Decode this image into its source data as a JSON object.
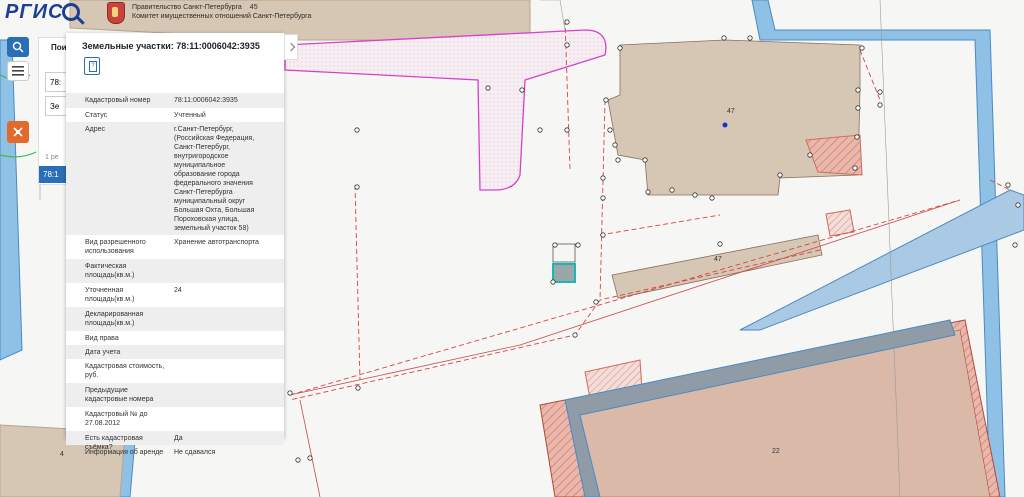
{
  "header": {
    "logo": "РГИС",
    "gov_line1": "Правительство Санкт-Петербурга",
    "gov_number": "45",
    "gov_line2": "Комитет имущественных отношений Санкт-Петербурга"
  },
  "background_panel": {
    "title": "Пои",
    "field1": "78:",
    "field2": "Зе",
    "results": "1 ре",
    "selected": "78:1"
  },
  "popup": {
    "title": "Земельные участки: 78:11:0006042:3935",
    "help_icon": "question-doc-icon",
    "rows": [
      {
        "key": "Кадастровый номер",
        "value": "78:11:0006042:3935"
      },
      {
        "key": "Статус",
        "value": "Учтенный"
      },
      {
        "key": "Адрес",
        "value": "г.Санкт-Петербург, (Российская Федерация, Санкт-Петербург, внутригородское муниципальное образование города федерального значения Санкт-Петербурга муниципальный округ Большая Охта, Большая Пороховская улица, земельный участок 58)"
      },
      {
        "key": "Вид разрешенного использования",
        "value": "Хранение автотранспорта"
      },
      {
        "key": "Фактическая площадь(кв.м.)",
        "value": ""
      },
      {
        "key": "Уточненная площадь(кв.м.)",
        "value": "24"
      },
      {
        "key": "Декларированная площадь(кв.м.)",
        "value": ""
      },
      {
        "key": "Вид права",
        "value": ""
      },
      {
        "key": "Дата учета",
        "value": ""
      },
      {
        "key": "Кадастровая стоимость, руб.",
        "value": ""
      },
      {
        "key": "Предыдущие кадастровые номера",
        "value": ""
      },
      {
        "key": "Кадастровый № до 27.08.2012",
        "value": ""
      },
      {
        "key": "Есть кадастровая съёмка?",
        "value": "Да"
      },
      {
        "key": "Информация об аренде",
        "value": "Не сдавался"
      }
    ]
  },
  "map_labels": {
    "building_main": "47",
    "building_strip": "47",
    "building_bottom": "22",
    "building_left": "4"
  },
  "colors": {
    "accent": "#2a6fb6",
    "road_outline": "#d940c9",
    "parcel_line": "#d64545",
    "building_fill": "#d6c6b4",
    "water_blue": "#7fb3dd"
  },
  "icons": {
    "search": "search-icon",
    "menu": "menu-icon",
    "layer": "layer-tool-icon",
    "collapse": "chevron-right-icon"
  }
}
